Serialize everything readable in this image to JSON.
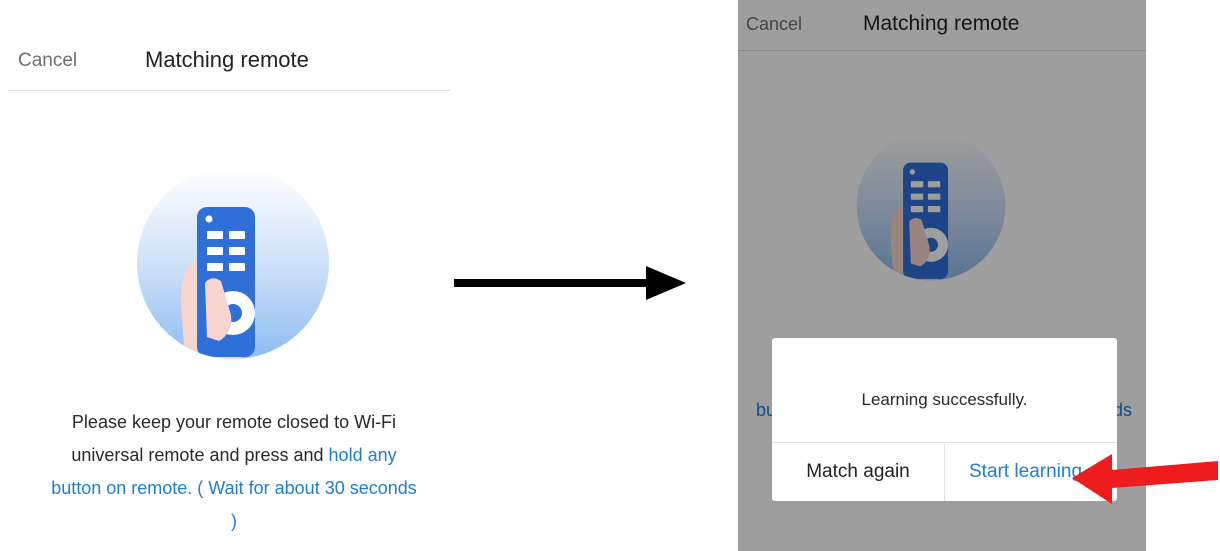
{
  "left_screen": {
    "cancel_label": "Cancel",
    "title": "Matching remote",
    "message": {
      "line1": "Please keep your remote closed to Wi-Fi",
      "line2_plain": "universal remote and press and ",
      "line2_highlight": "hold any",
      "line3": "button on remote. ( Wait for about 30 seconds",
      "line4": ")"
    }
  },
  "right_screen": {
    "cancel_label": "Cancel",
    "title": "Matching remote",
    "peek_left": "bu",
    "peek_right": "ds",
    "dialog": {
      "message": "Learning successfully.",
      "match_again_label": "Match again",
      "start_learning_label": "Start learning"
    }
  },
  "colors": {
    "accent": "#1e7ed4",
    "remote_blue": "#2f6fd8",
    "arrow_black": "#000000",
    "arrow_red": "#ee1c1c"
  }
}
